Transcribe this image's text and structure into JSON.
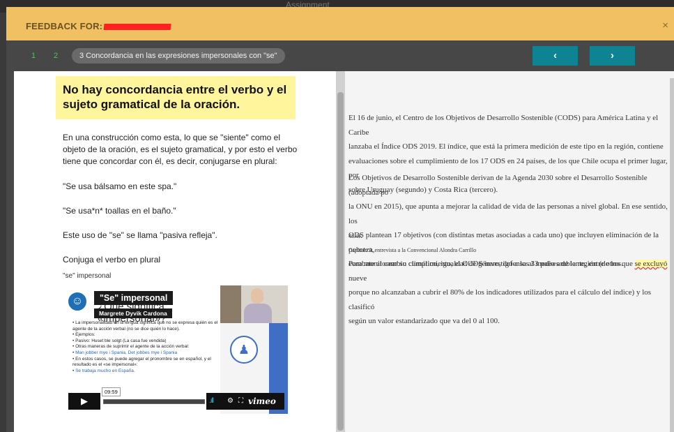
{
  "background_bar": {
    "left_text": "",
    "center_text": "Assignment"
  },
  "header": {
    "title_prefix": "FEEDBACK FOR:",
    "close_label": "×",
    "accent_color": "#f1c062"
  },
  "nav": {
    "steps": [
      "1",
      "2"
    ],
    "current_step": "3  Concordancia en las expresiones impersonales con \"se\"",
    "prev_label": "‹",
    "next_label": "›",
    "button_color": "#0e8493",
    "step_color": "#51c25a"
  },
  "feedback": {
    "callout": "No hay concordancia entre el verbo y el sujeto gramatical de la oración.",
    "explanation": "En una construcción como esta, lo que se \"siente\" como el objeto de la oración, es el sujeto gramatical, y por esto el verbo tiene que concordar con él, es decir, conjugarse en plural:",
    "example1": "\"Se usa bálsamo en este spa.\"",
    "example2": "\"Se usa*n* toallas en el baño.\"",
    "rule": "Este uso de \"se\" se llama \"pasiva refleja\".",
    "instruction": "Conjuga el verbo en plural",
    "tag": "\"se\" impersonal"
  },
  "video": {
    "title": "\"Se\" impersonal",
    "author": "Margrete Dyvik Cardona",
    "slide_heading": "¿Qué significa «impersonal»?",
    "bullets": [
      {
        "text": "La impersonalidad en la lengua significa que no se expresa quién es el agente de la acción verbal (no se dice quién lo hace).",
        "blue": false
      },
      {
        "text": "Ejemplos:",
        "blue": false
      },
      {
        "text": "Pasivo: Huset ble solgt (La casa fue vendida)",
        "blue": false
      },
      {
        "text": "Otras maneras de suprimir el agente de la acción verbal:",
        "blue": false
      },
      {
        "text": "Man jobber mye i Spania, Det jobbes mye i Spania",
        "blue": true
      },
      {
        "text": "En estos casos, se puede agregar el pronombre se en español, y el resultado es el «se impersonal»:",
        "blue": false
      },
      {
        "text": "Se trabaja mucho en España.",
        "blue": true
      }
    ],
    "time": "09:59",
    "play_icon": "play-icon",
    "brand": "vimeo"
  },
  "document": {
    "p1": "El 16 de junio, el Centro de los Objetivos de Desarrollo Sostenible (CODS) para América Latina y el Caribe\nlanzaba el Índice ODS 2019. El índice, que está la primera medición de este tipo en la región, contiene\nevaluaciones sobre el cumplimiento de los 17 ODS en 24 países, de los que Chile ocupa el primer lugar, por\nsobre Uruguay (segundo) y Costa Rica (tercero).",
    "p2": "Los Objetivos de Desarrollo Sostenible derivan de la Agenda 2030 sobre el Desarrollo Sostenible (adoptada po\nla ONU en 2015), que apunta a mejorar la calidad de vida de las personas a nivel global. En ese sentido, los\nODS plantean 17 objetivos (con distintas metas asociadas a cada uno) que incluyen eliminación de la pobreza,\ncombate al cambio climático, igualdad de género, defensa al medio ambiente, entre otros.",
    "meta1": "48.4K",
    "meta2": "Capítulo 9, entrevista a la Convencional Alondra Carrillo",
    "p3_before": "Para monitorear su cumplimiento, el CODS investigó a los 33 países de la región (de los que ",
    "p3_highlight": "se excluyó",
    "p3_after": " nueve\nporque no alcanzaban a cubrir el 80% de los indicadores utilizados para el cálculo del índice) y los clasificó\nsegún un valor estandarizado que va del 0 al 100."
  }
}
